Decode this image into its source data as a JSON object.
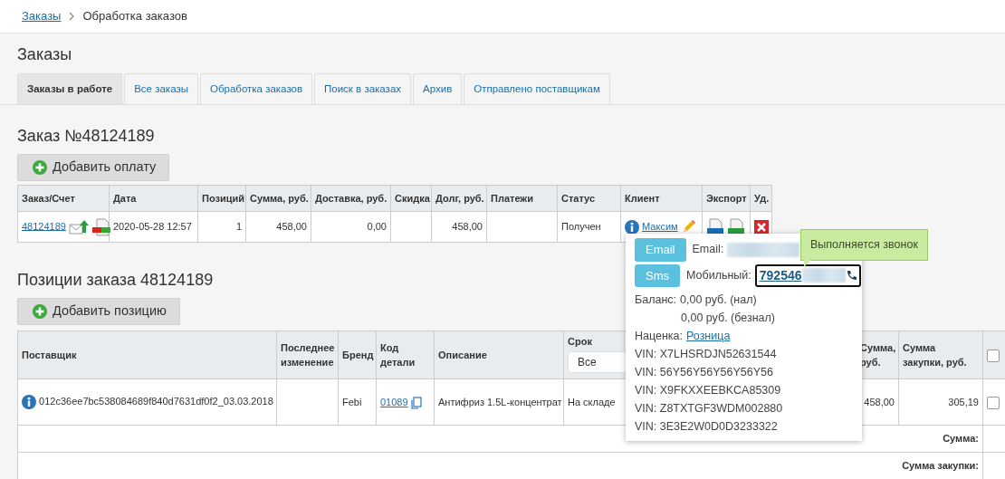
{
  "breadcrumb": [
    {
      "label": "Заказы",
      "link": true
    },
    {
      "label": "Обработка заказов",
      "link": false
    }
  ],
  "page_title": "Заказы",
  "tabs": [
    {
      "label": "Заказы в работе",
      "selected": true
    },
    {
      "label": "Все заказы",
      "selected": false
    },
    {
      "label": "Обработка заказов",
      "selected": false
    },
    {
      "label": "Поиск в заказах",
      "selected": false
    },
    {
      "label": "Архив",
      "selected": false
    },
    {
      "label": "Отправлено поставщикам",
      "selected": false
    }
  ],
  "order": {
    "title": "Заказ №48124189",
    "add_button": "Добавить оплату",
    "columns": [
      "Заказ/Счет",
      "Дата",
      "Позиций",
      "Сумма, руб.",
      "Доставка, руб.",
      "Скидка",
      "Долг, руб.",
      "Платежи",
      "Статус",
      "Клиент",
      "Экспорт",
      "Уд."
    ],
    "row": {
      "order_number": "48124189",
      "date": "2020-05-28 12:57",
      "positions": "1",
      "sum": "458,00",
      "delivery": "0,00",
      "debt": "458,00",
      "status": "Получен",
      "client": "Максим"
    }
  },
  "positions": {
    "title": "Позиции заказа 48124189",
    "add_button": "Добавить позицию",
    "columns": [
      "Поставщик",
      "Последнее изменение",
      "Бренд",
      "Код детали",
      "Описание",
      "Срок",
      "Сумма, руб.",
      "Сумма закупки, руб."
    ],
    "term_filter": "Все",
    "select_all_checked": false,
    "row": {
      "supplier": "012c36ee7bc538084689f840d7631df0f2_03.03.2018",
      "brand": "Febi",
      "part_code": "01089",
      "description": "Антифриз 1.5L-концентрат",
      "term": "На складе",
      "sum": "458,00",
      "purchase_sum": "305,19",
      "checked": false
    },
    "totals": [
      "Сумма:",
      "Сумма закупки:"
    ]
  },
  "client_popover": {
    "email_button": "Email",
    "sms_button": "Sms",
    "email_label": "Email:",
    "mobile_label": "Мобильный:",
    "phone": "792546",
    "balance_label": "Баланс:",
    "balances": [
      "0,00 руб. (нал)",
      "0,00 руб. (безнал)"
    ],
    "markup_label": "Наценка:",
    "markup": "Розница",
    "vins": [
      "VIN: X7LHSRDJN52631544",
      "VIN: 56Y56Y56Y56Y56Y56",
      "VIN: X9FKXXEEBKCA85309",
      "VIN: Z8TXTGF3WDM002880",
      "VIN: 3E3E2W0D0D3233322"
    ]
  },
  "tooltip": "Выполняется звонок"
}
